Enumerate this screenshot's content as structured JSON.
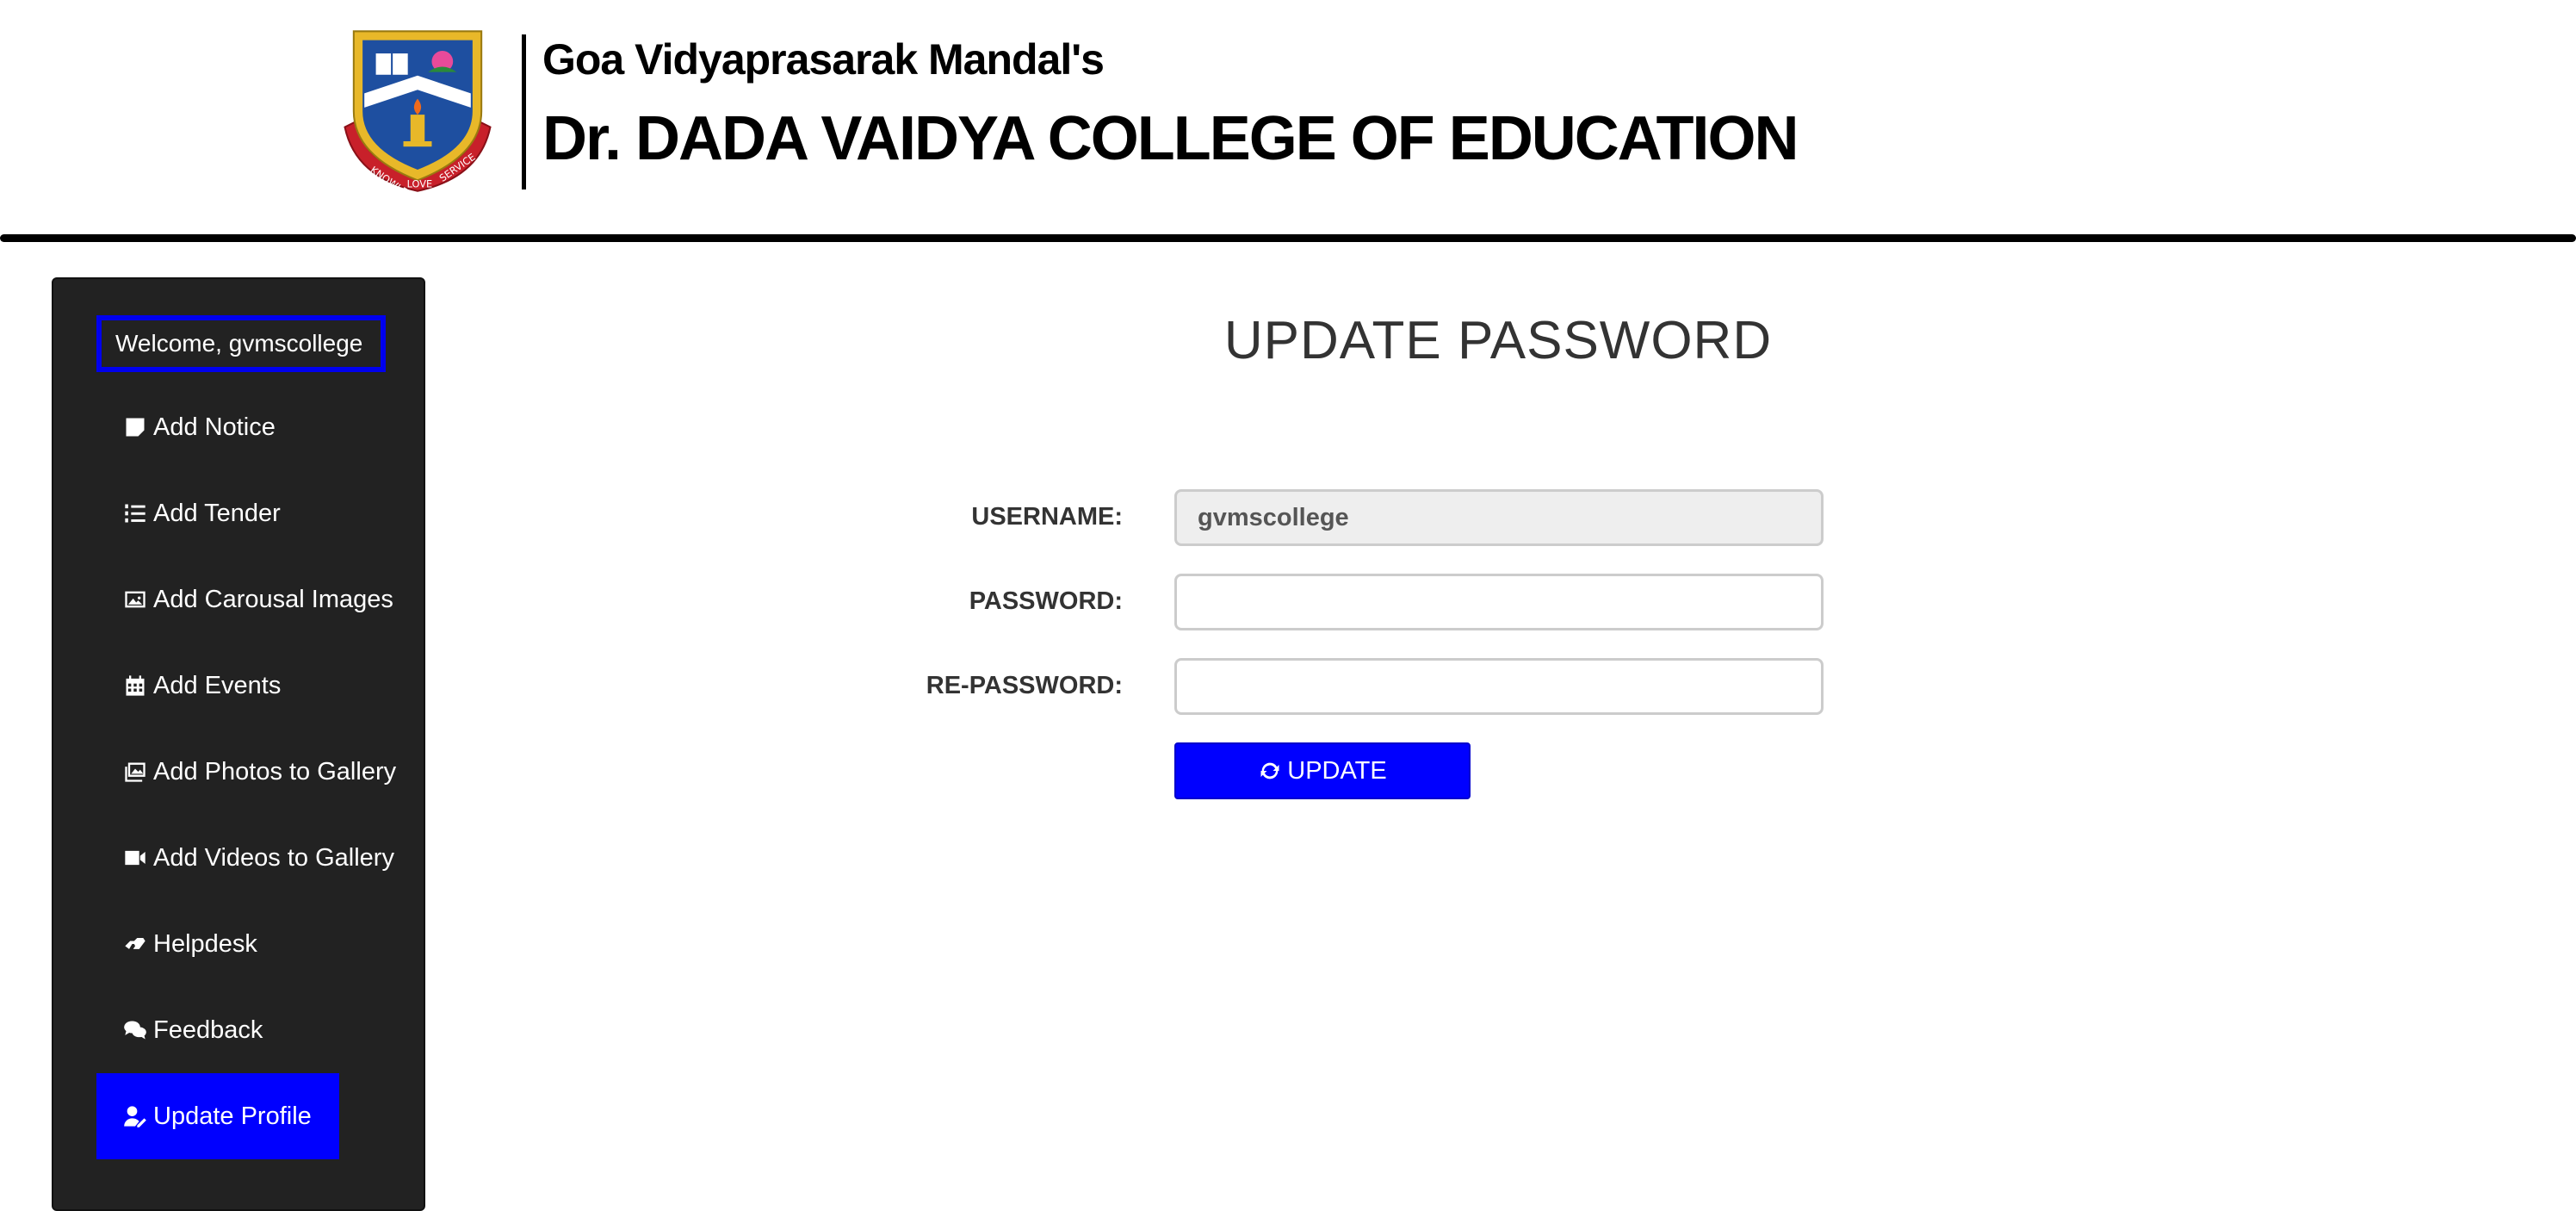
{
  "header": {
    "org_name": "Goa Vidyaprasarak Mandal's",
    "college_name": "Dr. DADA VAIDYA COLLEGE OF EDUCATION",
    "logo_motto": [
      "KNOWLEDGE",
      "LOVE",
      "SERVICE"
    ]
  },
  "sidebar": {
    "welcome": "Welcome, gvmscollege",
    "items": [
      {
        "label": "Add Notice",
        "icon": "sticky-note-icon"
      },
      {
        "label": "Add Tender",
        "icon": "list-ol-icon"
      },
      {
        "label": "Add Carousal Images",
        "icon": "image-icon"
      },
      {
        "label": "Add Events",
        "icon": "calendar-icon"
      },
      {
        "label": "Add Photos to Gallery",
        "icon": "images-icon"
      },
      {
        "label": "Add Videos to Gallery",
        "icon": "video-icon"
      },
      {
        "label": "Helpdesk",
        "icon": "hands-helping-icon"
      },
      {
        "label": "Feedback",
        "icon": "comments-icon"
      },
      {
        "label": "Update Profile",
        "icon": "user-edit-icon",
        "active": true
      }
    ]
  },
  "main": {
    "title": "UPDATE PASSWORD",
    "form": {
      "username_label": "USERNAME:",
      "username_value": "gvmscollege",
      "password_label": "PASSWORD:",
      "password_value": "",
      "repassword_label": "RE-PASSWORD:",
      "repassword_value": "",
      "submit_label": "UPDATE"
    }
  },
  "colors": {
    "accent": "#0000ff",
    "sidebar_bg": "#222222",
    "readonly_bg": "#eeeeee"
  }
}
